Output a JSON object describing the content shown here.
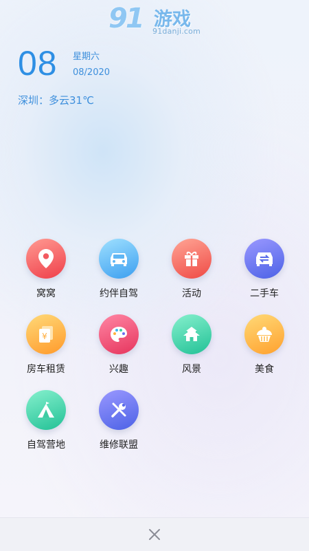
{
  "logo": {
    "number": "91",
    "text": "游戏",
    "url": "91danji.com"
  },
  "date": {
    "day": "08",
    "weekday": "星期六",
    "month_year": "08/2020"
  },
  "weather": "深圳：多云31℃",
  "items": [
    {
      "label": "窝窝",
      "icon": "location-pin-icon",
      "color_from": "#ff8f8a",
      "color_to": "#f0434d"
    },
    {
      "label": "约伴自驾",
      "icon": "car-icon",
      "color_from": "#8fd8ff",
      "color_to": "#41a4f2"
    },
    {
      "label": "活动",
      "icon": "gift-icon",
      "color_from": "#ff9a8a",
      "color_to": "#f04a45"
    },
    {
      "label": "二手车",
      "icon": "used-car-icon",
      "color_from": "#8e8cff",
      "color_to": "#4d64e8"
    },
    {
      "label": "房车租赁",
      "icon": "rental-money-icon",
      "color_from": "#ffd16a",
      "color_to": "#ff9a2e"
    },
    {
      "label": "兴趣",
      "icon": "palette-icon",
      "color_from": "#ff7c9e",
      "color_to": "#e8375f"
    },
    {
      "label": "风景",
      "icon": "pavilion-icon",
      "color_from": "#7deec9",
      "color_to": "#26c49a"
    },
    {
      "label": "美食",
      "icon": "cupcake-icon",
      "color_from": "#ffd36b",
      "color_to": "#ffa531"
    },
    {
      "label": "自驾营地",
      "icon": "camp-tent-icon",
      "color_from": "#7deec9",
      "color_to": "#26c49a"
    },
    {
      "label": "维修联盟",
      "icon": "repair-tools-icon",
      "color_from": "#8e8cff",
      "color_to": "#4d64e8"
    }
  ],
  "bottom": {
    "close_icon": "close-icon"
  }
}
